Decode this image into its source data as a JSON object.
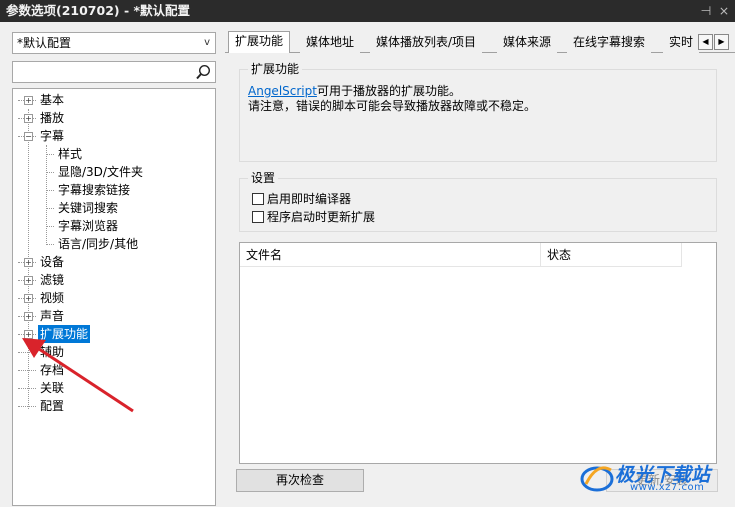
{
  "window": {
    "title": "参数选项(210702) - *默认配置",
    "pin_icon": "pin-icon",
    "close_icon": "close-icon"
  },
  "preset": {
    "value": "*默认配置",
    "arrow": "v"
  },
  "search": {
    "value": "",
    "icon": "search-icon"
  },
  "tree": {
    "items": [
      {
        "label": "基本",
        "level": 0,
        "expander": "+"
      },
      {
        "label": "播放",
        "level": 0,
        "expander": "+"
      },
      {
        "label": "字幕",
        "level": 0,
        "expander": "−"
      },
      {
        "label": "样式",
        "level": 1
      },
      {
        "label": "显隐/3D/文件夹",
        "level": 1
      },
      {
        "label": "字幕搜索链接",
        "level": 1
      },
      {
        "label": "关键词搜索",
        "level": 1
      },
      {
        "label": "字幕浏览器",
        "level": 1
      },
      {
        "label": "语言/同步/其他",
        "level": 1
      },
      {
        "label": "设备",
        "level": 0,
        "expander": "+"
      },
      {
        "label": "滤镜",
        "level": 0,
        "expander": "+"
      },
      {
        "label": "视频",
        "level": 0,
        "expander": "+"
      },
      {
        "label": "声音",
        "level": 0,
        "expander": "+"
      },
      {
        "label": "扩展功能",
        "level": 0,
        "expander": "+",
        "selected": true
      },
      {
        "label": "辅助",
        "level": 0
      },
      {
        "label": "存档",
        "level": 0
      },
      {
        "label": "关联",
        "level": 0
      },
      {
        "label": "配置",
        "level": 0
      }
    ]
  },
  "tabs": [
    "扩展功能",
    "媒体地址",
    "媒体播放列表/项目",
    "媒体来源",
    "在线字幕搜索",
    "实时"
  ],
  "tab_scroll": {
    "left": "◀",
    "right": "▶"
  },
  "extension_group": {
    "title": "扩展功能",
    "link": "AngelScript",
    "line1_rest": "可用于播放器的扩展功能。",
    "line2": "请注意，错误的脚本可能会导致播放器故障或不稳定。"
  },
  "settings_group": {
    "title": "设置",
    "options": [
      {
        "label": "启用即时编译器",
        "checked": false
      },
      {
        "label": "程序启动时更新扩展",
        "checked": false
      }
    ]
  },
  "file_list": {
    "columns": [
      "文件名",
      "状态"
    ],
    "rows": []
  },
  "buttons": {
    "recheck": "再次检查",
    "update": "更新/安装"
  },
  "watermark": {
    "text": "极光下载站",
    "url": "www.xz7.com"
  },
  "colors": {
    "selection": "#0078d7",
    "titlebar": "#2b2b2b",
    "annotation_arrow": "#d9232b",
    "link": "#0066cc"
  }
}
